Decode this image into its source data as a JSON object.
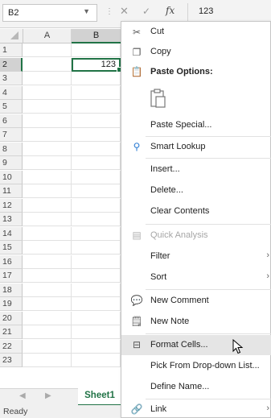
{
  "formula_bar": {
    "name_box": "B2",
    "fx_label": "fx",
    "value": "123"
  },
  "columns": [
    "A",
    "B"
  ],
  "rows": [
    "1",
    "2",
    "3",
    "4",
    "5",
    "6",
    "7",
    "8",
    "9",
    "10",
    "11",
    "12",
    "13",
    "14",
    "15",
    "16",
    "17",
    "18",
    "19",
    "20",
    "21",
    "22",
    "23"
  ],
  "active_cell": {
    "address": "B2",
    "value": "123"
  },
  "sheet_tabs": [
    "Sheet1"
  ],
  "status": "Ready",
  "context_menu": {
    "cut": "Cut",
    "copy": "Copy",
    "paste_options": "Paste Options:",
    "paste_special": "Paste Special...",
    "smart_lookup": "Smart Lookup",
    "insert": "Insert...",
    "delete": "Delete...",
    "clear_contents": "Clear Contents",
    "quick_analysis": "Quick Analysis",
    "filter": "Filter",
    "sort": "Sort",
    "new_comment": "New Comment",
    "new_note": "New Note",
    "format_cells": "Format Cells...",
    "pick_from_dropdown": "Pick From Drop-down List...",
    "define_name": "Define Name...",
    "link": "Link"
  },
  "colors": {
    "accent": "#217346",
    "hover": "#e5e5e5"
  }
}
